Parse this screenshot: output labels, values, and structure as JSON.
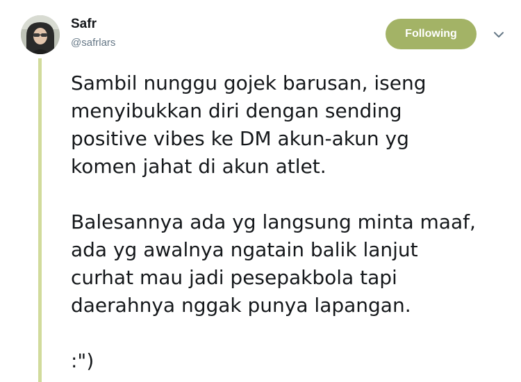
{
  "user": {
    "display_name": "Safr",
    "handle": "@safrlars"
  },
  "follow_button": {
    "label": "Following",
    "color": "#a3b366"
  },
  "menu": {
    "icon": "chevron-down-icon"
  },
  "tweet": {
    "paragraphs": [
      "Sambil nunggu gojek barusan, iseng\nmenyibukkan diri dengan sending\npositive vibes ke DM akun-akun yg\nkomen jahat di akun atlet.",
      "Balesannya ada yg langsung minta maaf,\nada yg awalnya ngatain balik lanjut\ncurhat mau jadi pesepakbola tapi\ndaerahnya nggak punya lapangan.",
      ":\")"
    ]
  },
  "colors": {
    "thread_line": "#d1db9c",
    "handle": "#657786",
    "text": "#14171a"
  }
}
